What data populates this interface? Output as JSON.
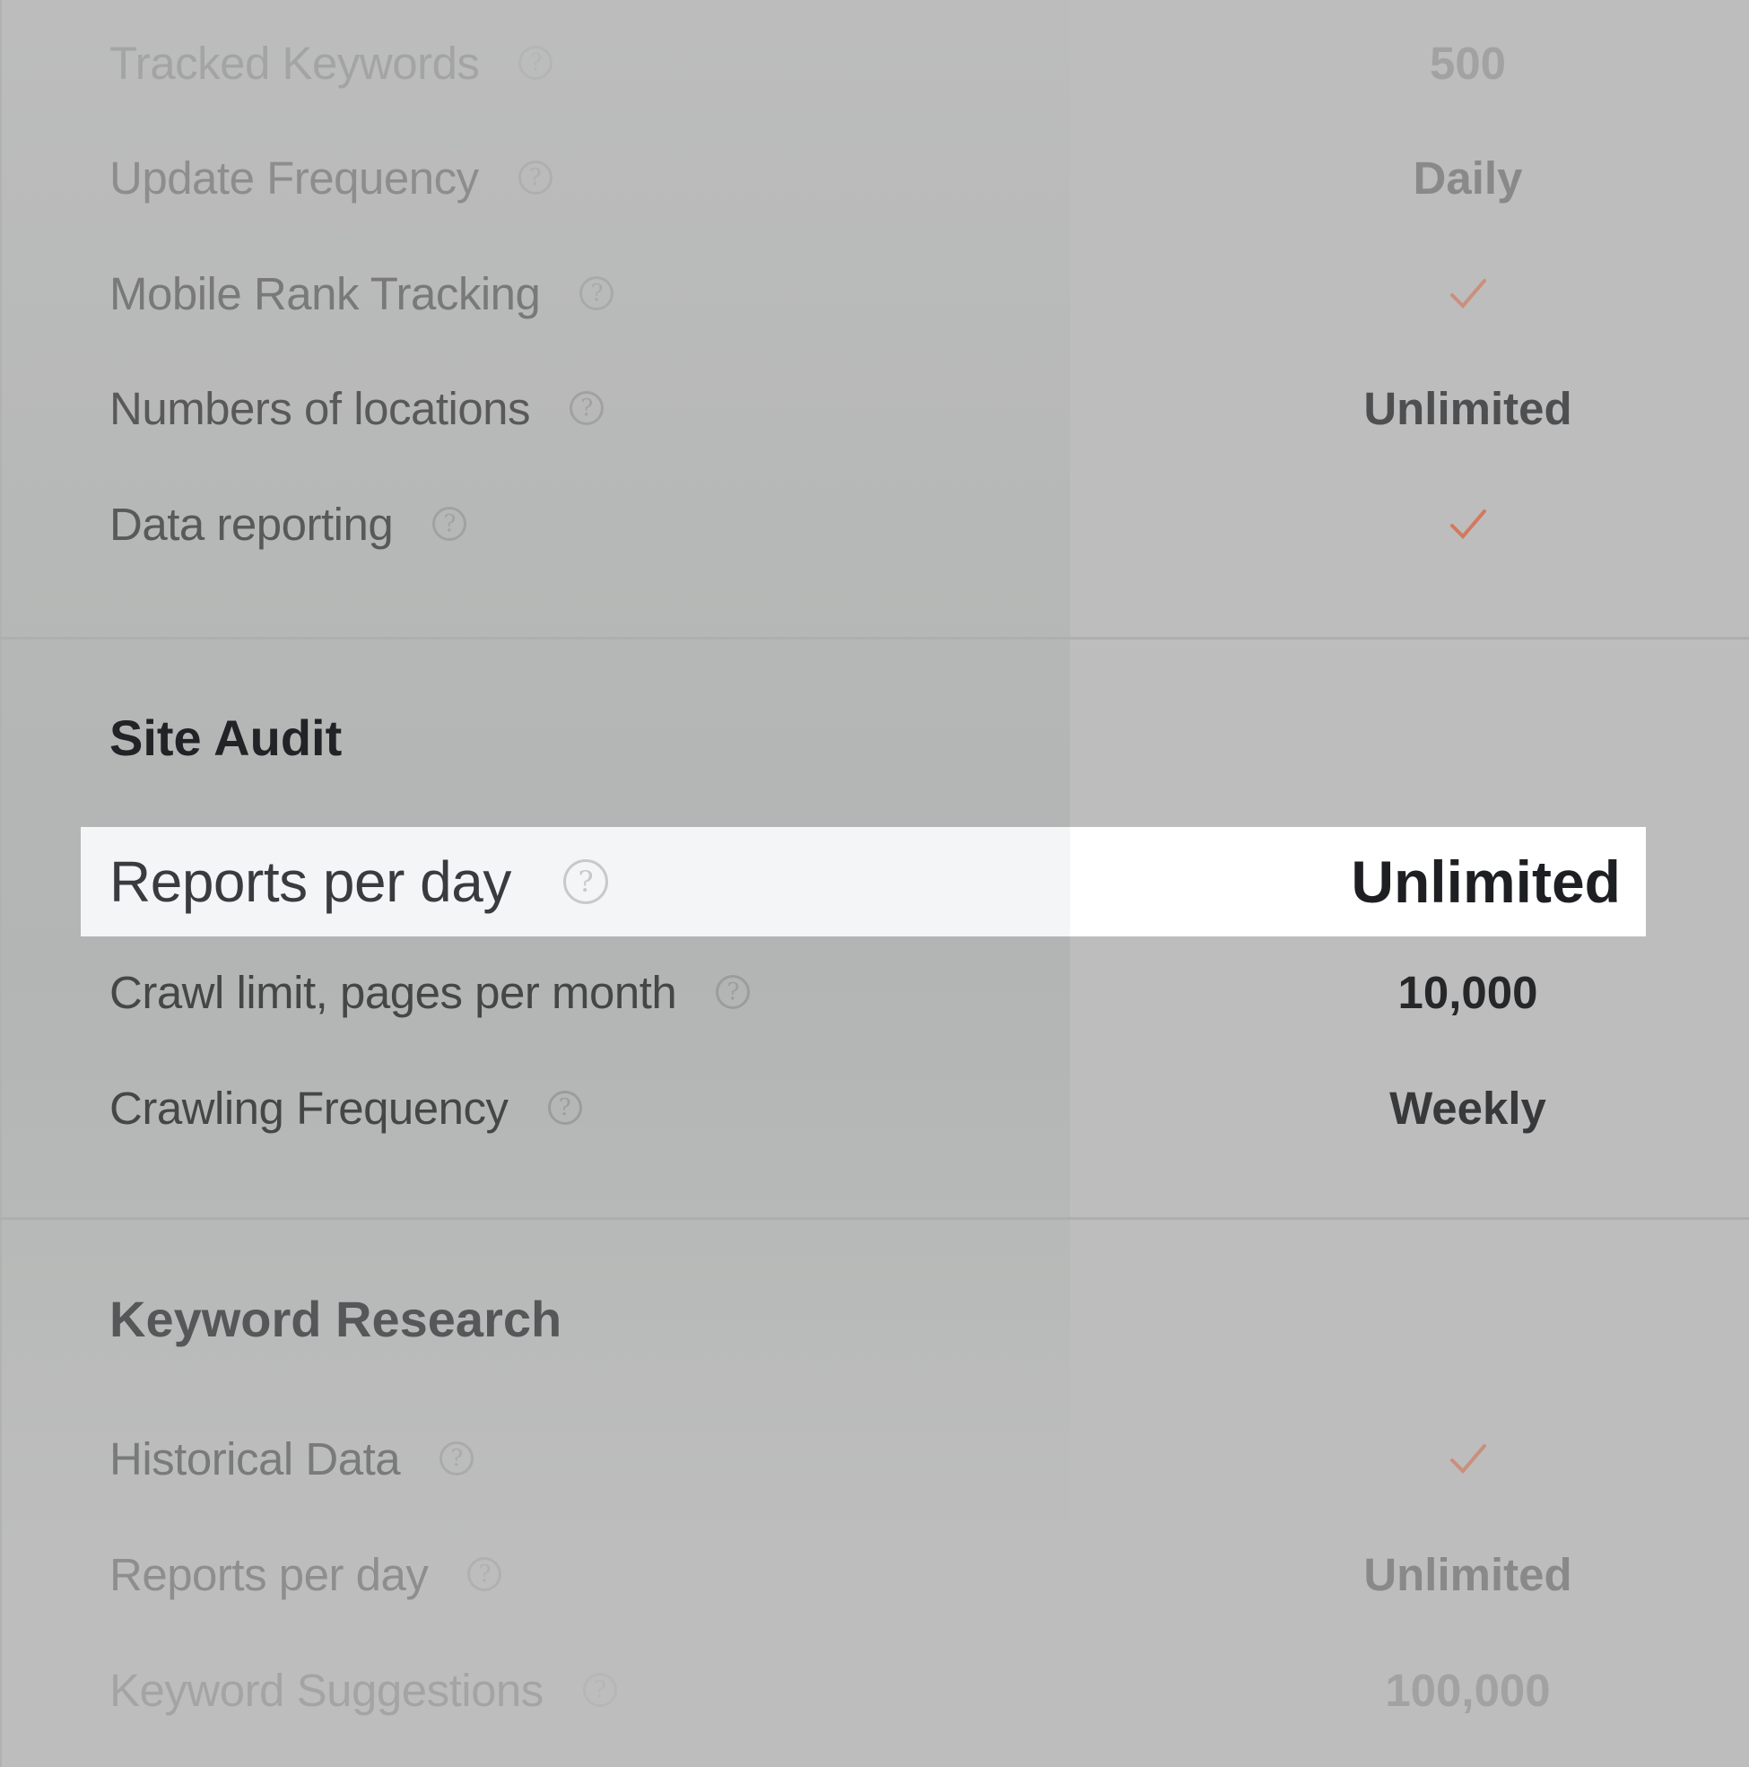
{
  "colors": {
    "accent_check": "#d9633f",
    "highlight_left": "#f4f5f7",
    "highlight_right": "#ffffff",
    "overlay": "#bdbdbd"
  },
  "rank_tracking": {
    "rows": [
      {
        "label": "Tracked Keywords",
        "value": "500"
      },
      {
        "label": "Update Frequency",
        "value": "Daily"
      },
      {
        "label": "Mobile Rank Tracking",
        "value": "check-icon"
      },
      {
        "label": "Numbers of locations",
        "value": "Unlimited"
      },
      {
        "label": "Data reporting",
        "value": "check-icon"
      }
    ]
  },
  "site_audit": {
    "title": "Site Audit",
    "highlighted_row": {
      "label": "Reports per day",
      "value": "Unlimited"
    },
    "rows": [
      {
        "label": "Crawl limit, pages per month",
        "value": "10,000"
      },
      {
        "label": "Crawling Frequency",
        "value": "Weekly"
      }
    ]
  },
  "keyword_research": {
    "title": "Keyword Research",
    "rows": [
      {
        "label": "Historical Data",
        "value": "check-icon"
      },
      {
        "label": "Reports per day",
        "value": "Unlimited"
      },
      {
        "label": "Keyword Suggestions",
        "value": "100,000"
      }
    ]
  },
  "help_glyph": "?"
}
